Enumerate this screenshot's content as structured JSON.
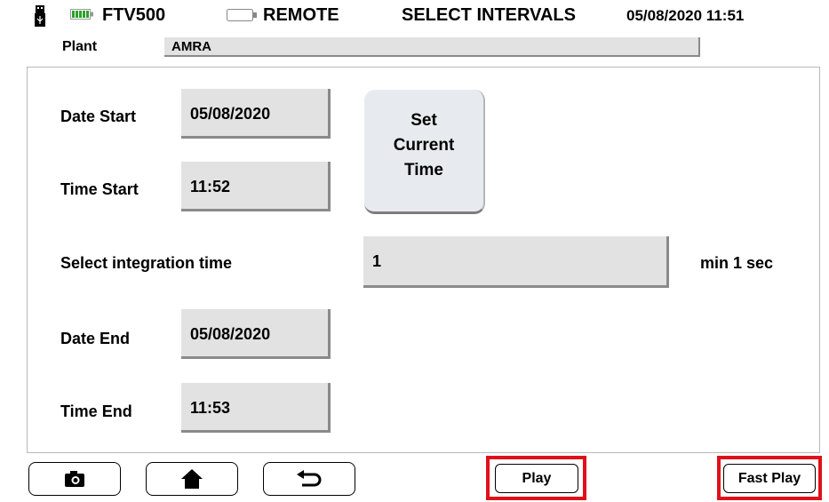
{
  "header": {
    "device": "FTV500",
    "mode": "REMOTE",
    "page_title": "SELECT INTERVALS",
    "datetime": "05/08/2020 11:51",
    "icons": [
      "usb-icon",
      "battery-icon",
      "battery-icon"
    ]
  },
  "plant": {
    "label": "Plant",
    "value": "AMRA"
  },
  "form": {
    "date_start": {
      "label": "Date Start",
      "value": "05/08/2020"
    },
    "time_start": {
      "label": "Time Start",
      "value": "11:52"
    },
    "set_time_button": {
      "line1": "Set",
      "line2": "Current",
      "line3": "Time"
    },
    "integration": {
      "label": "Select integration time",
      "value": "1",
      "unit": "min 1 sec"
    },
    "date_end": {
      "label": "Date End",
      "value": "05/08/2020"
    },
    "time_end": {
      "label": "Time End",
      "value": "11:53"
    }
  },
  "toolbar": {
    "nav_icons": [
      "camera-icon",
      "home-icon",
      "back-icon"
    ],
    "play_label": "Play",
    "fast_play_label": "Fast Play",
    "highlight_color": "#e0101a"
  }
}
